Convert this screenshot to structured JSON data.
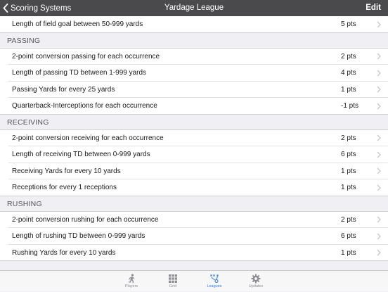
{
  "nav": {
    "back_label": "Scoring Systems",
    "title": "Yardage League",
    "edit_label": "Edit"
  },
  "top_row": {
    "label": "Length of field goal between 50-999 yards",
    "points": "5 pts"
  },
  "sections": [
    {
      "header": "PASSING",
      "rows": [
        {
          "label": "2-point conversion passing for each occurrence",
          "points": "2 pts"
        },
        {
          "label": "Length of passing TD between 1-999 yards",
          "points": "4 pts"
        },
        {
          "label": "Passing Yards for every 25 yards",
          "points": "1 pts"
        },
        {
          "label": "Quarterback-Interceptions for each occurrence",
          "points": "-1 pts"
        }
      ]
    },
    {
      "header": "RECEIVING",
      "rows": [
        {
          "label": "2-point conversion receiving for each occurrence",
          "points": "2 pts"
        },
        {
          "label": "Length of receiving TD between 0-999 yards",
          "points": "6 pts"
        },
        {
          "label": "Receiving Yards for every 10 yards",
          "points": "1 pts"
        },
        {
          "label": "Receptions for every 1 receptions",
          "points": "1 pts"
        }
      ]
    },
    {
      "header": "RUSHING",
      "rows": [
        {
          "label": "2-point conversion rushing for each occurrence",
          "points": "2 pts"
        },
        {
          "label": "Length of rushing TD between 0-999 yards",
          "points": "6 pts"
        },
        {
          "label": "Rushing Yards for every 10 yards",
          "points": "1 pts"
        }
      ]
    }
  ],
  "tabs": [
    {
      "label": "Players",
      "icon": "runner-icon",
      "active": false
    },
    {
      "label": "Grid",
      "icon": "grid-icon",
      "active": false
    },
    {
      "label": "Leagues",
      "icon": "playbook-icon",
      "active": true
    },
    {
      "label": "Updates",
      "icon": "gear-icon",
      "active": false
    }
  ],
  "colors": {
    "navbar": "#4a4a4d",
    "accent": "#2f7fe0",
    "background": "#efeff4"
  }
}
